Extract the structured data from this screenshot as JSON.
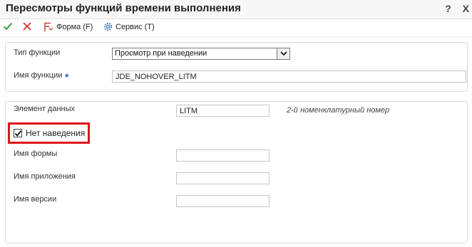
{
  "window": {
    "title": "Пересмотры функций времени выполнения",
    "help_glyph": "?",
    "close_glyph": "X"
  },
  "toolbar": {
    "form_label": "Форма",
    "form_key": "(F)",
    "service_label": "Сервис",
    "service_key": "(T)"
  },
  "section1": {
    "function_type_label": "Тип функции",
    "function_type_value": "Просмотр при наведении",
    "function_name_label": "Имя функции",
    "required_marker": "*",
    "function_name_value": "JDE_NOHOVER_LITM"
  },
  "section2": {
    "data_item_label": "Элемент данных",
    "data_item_value": "LITM",
    "data_item_description": "2-й номенклатурный номер",
    "no_hover_label": "Нет наведения",
    "no_hover_checked": true,
    "form_name_label": "Имя формы",
    "form_name_value": "",
    "app_name_label": "Имя приложения",
    "app_name_value": "",
    "version_name_label": "Имя версии",
    "version_name_value": ""
  },
  "colors": {
    "highlight": "#e0141e",
    "ok_check": "#2e9a2e",
    "cancel_x": "#d22a2a",
    "required": "#1b68c8"
  }
}
